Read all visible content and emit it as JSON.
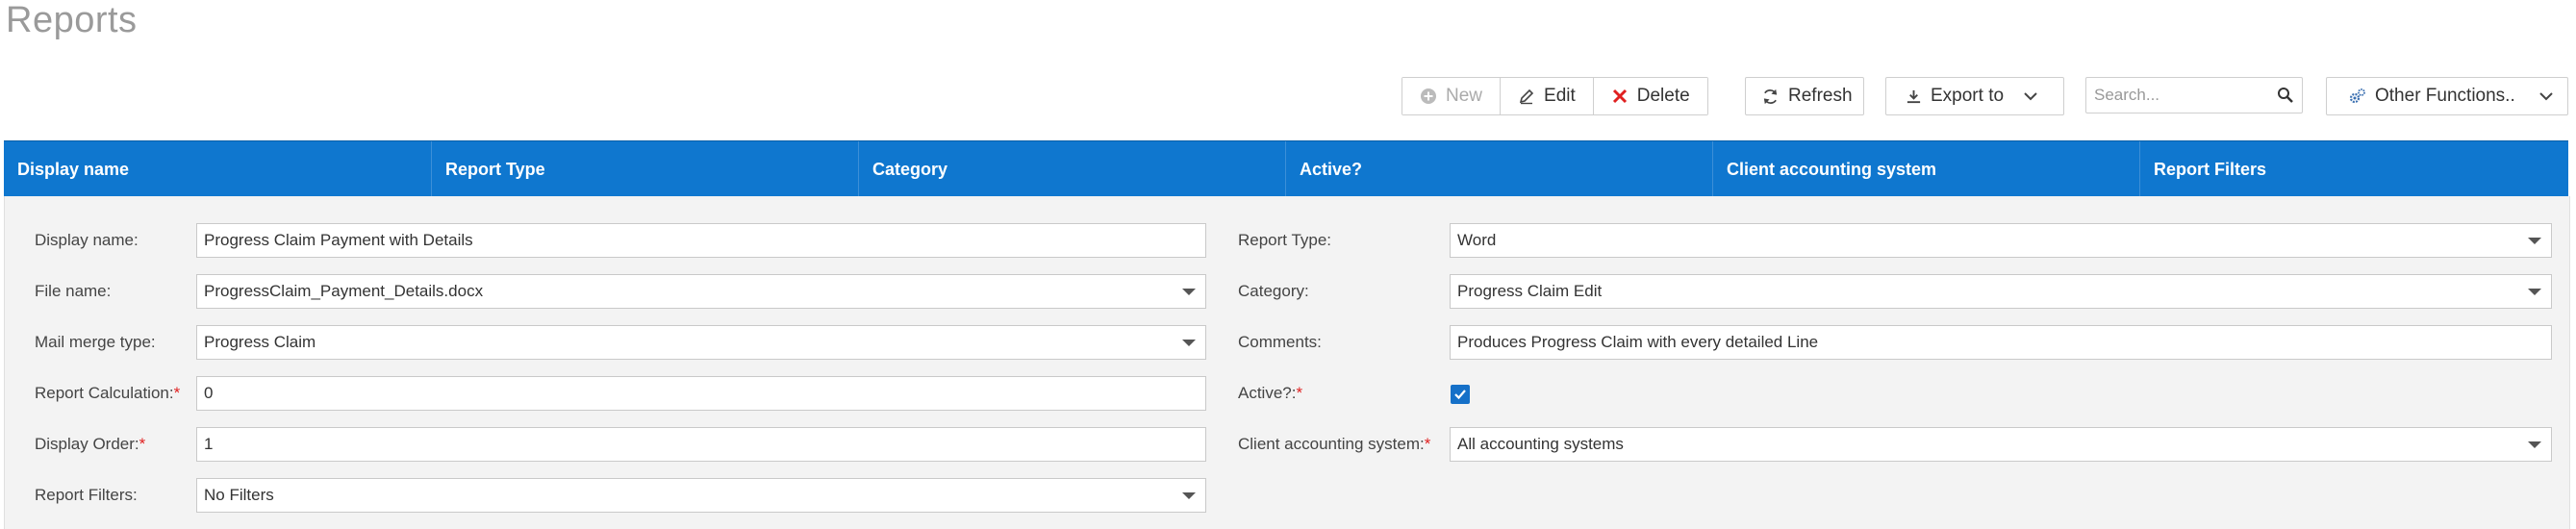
{
  "page": {
    "title": "Reports"
  },
  "toolbar": {
    "new_label": "New",
    "edit_label": "Edit",
    "delete_label": "Delete",
    "refresh_label": "Refresh",
    "export_label": "Export to",
    "search_placeholder": "Search...",
    "other_label": "Other Functions.."
  },
  "grid": {
    "columns": [
      "Display name",
      "Report Type",
      "Category",
      "Active?",
      "Client accounting system",
      "Report Filters"
    ],
    "header_color": "#0f77cf"
  },
  "form": {
    "display_name": {
      "label": "Display name:",
      "value": "Progress Claim Payment with Details"
    },
    "file_name": {
      "label": "File name:",
      "value": "ProgressClaim_Payment_Details.docx"
    },
    "mail_merge_type": {
      "label": "Mail merge type:",
      "value": "Progress Claim"
    },
    "report_calculation": {
      "label": "Report Calculation:",
      "req": "*",
      "value": "0"
    },
    "display_order": {
      "label": "Display Order:",
      "req": "*",
      "value": "1"
    },
    "report_filters": {
      "label": "Report Filters:",
      "value": "No Filters"
    },
    "report_type": {
      "label": "Report Type:",
      "value": "Word"
    },
    "category": {
      "label": "Category:",
      "value": "Progress Claim Edit"
    },
    "comments": {
      "label": "Comments:",
      "value": "Produces Progress Claim with every detailed Line"
    },
    "active": {
      "label": "Active?:",
      "req": "*",
      "checked": true
    },
    "client_accounting_system": {
      "label": "Client accounting system:",
      "req": "*",
      "value": "All accounting systems"
    }
  },
  "icons": {
    "new": "plus-circle-icon",
    "edit": "pencil-icon",
    "delete": "x-icon",
    "refresh": "refresh-icon",
    "export": "download-icon",
    "search": "search-icon",
    "other": "gears-icon"
  },
  "colors": {
    "delete_red": "#e02020",
    "checkbox_blue": "#1570c8"
  }
}
